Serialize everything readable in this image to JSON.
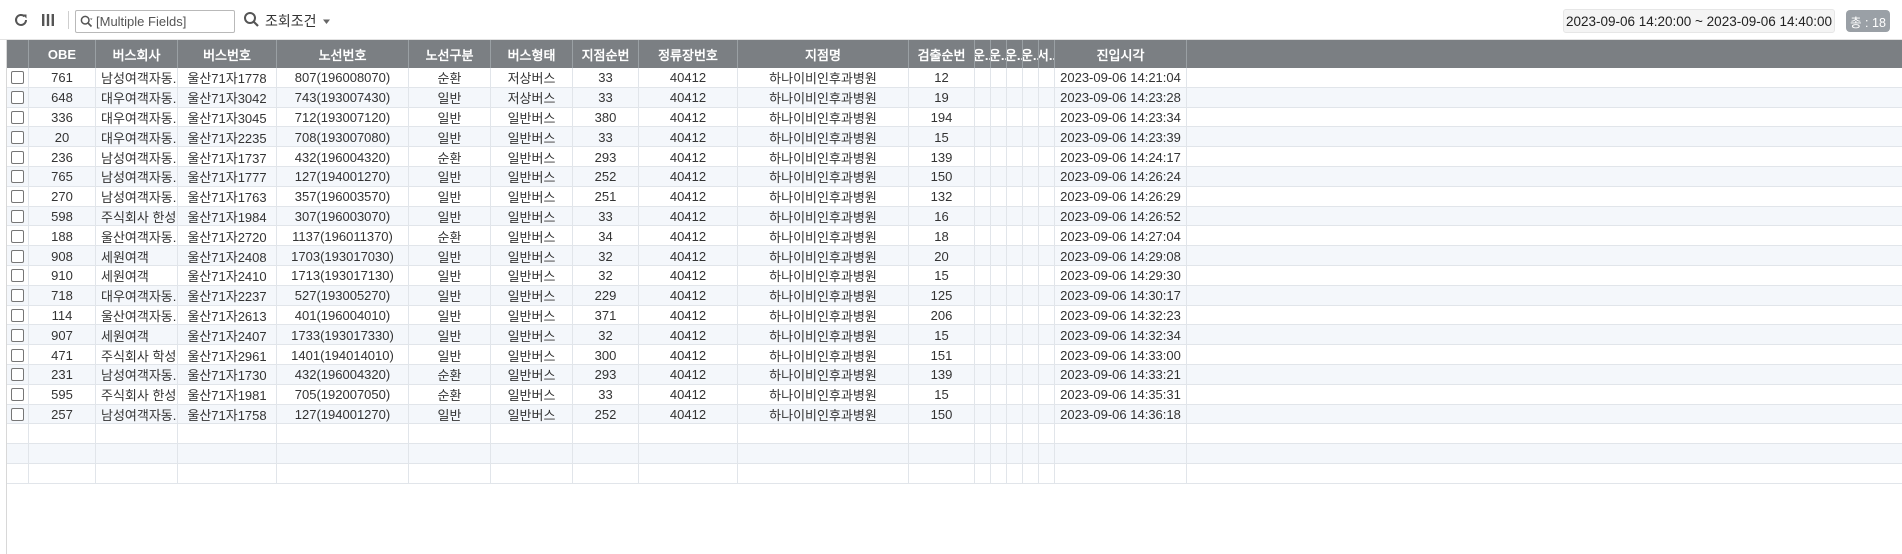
{
  "toolbar": {
    "search_placeholder": "[Multiple Fields]",
    "condition_label": "조회조건",
    "date_range": "2023-09-06 14:20:00 ~ 2023-09-06 14:40:00",
    "total_label": "총 : 18",
    "icons": [
      "refresh-icon",
      "columns-icon",
      "search-icon",
      "chevron-down-icon"
    ]
  },
  "table": {
    "columns": [
      "",
      "OBE",
      "버스회사",
      "버스번호",
      "노선번호",
      "노선구분",
      "버스형태",
      "지점순번",
      "정류장번호",
      "지점명",
      "검출순번",
      "운..",
      "운..",
      "운..",
      "운..",
      "서..",
      "진입시각"
    ],
    "rows": [
      [
        "761",
        "남성여객자동...",
        "울산71자1778",
        "807(196008070)",
        "순환",
        "저상버스",
        "33",
        "40412",
        "하나이비인후과병원",
        "12",
        "",
        "",
        "",
        "",
        "",
        "2023-09-06 14:21:04"
      ],
      [
        "648",
        "대우여객자동...",
        "울산71자3042",
        "743(193007430)",
        "일반",
        "저상버스",
        "33",
        "40412",
        "하나이비인후과병원",
        "19",
        "",
        "",
        "",
        "",
        "",
        "2023-09-06 14:23:28"
      ],
      [
        "336",
        "대우여객자동...",
        "울산71자3045",
        "712(193007120)",
        "일반",
        "일반버스",
        "380",
        "40412",
        "하나이비인후과병원",
        "194",
        "",
        "",
        "",
        "",
        "",
        "2023-09-06 14:23:34"
      ],
      [
        "20",
        "대우여객자동...",
        "울산71자2235",
        "708(193007080)",
        "일반",
        "일반버스",
        "33",
        "40412",
        "하나이비인후과병원",
        "15",
        "",
        "",
        "",
        "",
        "",
        "2023-09-06 14:23:39"
      ],
      [
        "236",
        "남성여객자동...",
        "울산71자1737",
        "432(196004320)",
        "순환",
        "일반버스",
        "293",
        "40412",
        "하나이비인후과병원",
        "139",
        "",
        "",
        "",
        "",
        "",
        "2023-09-06 14:24:17"
      ],
      [
        "765",
        "남성여객자동...",
        "울산71자1777",
        "127(194001270)",
        "일반",
        "일반버스",
        "252",
        "40412",
        "하나이비인후과병원",
        "150",
        "",
        "",
        "",
        "",
        "",
        "2023-09-06 14:26:24"
      ],
      [
        "270",
        "남성여객자동...",
        "울산71자1763",
        "357(196003570)",
        "일반",
        "일반버스",
        "251",
        "40412",
        "하나이비인후과병원",
        "132",
        "",
        "",
        "",
        "",
        "",
        "2023-09-06 14:26:29"
      ],
      [
        "598",
        "주식회사 한성...",
        "울산71자1984",
        "307(196003070)",
        "일반",
        "일반버스",
        "33",
        "40412",
        "하나이비인후과병원",
        "16",
        "",
        "",
        "",
        "",
        "",
        "2023-09-06 14:26:52"
      ],
      [
        "188",
        "울산여객자동...",
        "울산71자2720",
        "1137(196011370)",
        "순환",
        "일반버스",
        "34",
        "40412",
        "하나이비인후과병원",
        "18",
        "",
        "",
        "",
        "",
        "",
        "2023-09-06 14:27:04"
      ],
      [
        "908",
        "세원여객",
        "울산71자2408",
        "1703(193017030)",
        "일반",
        "일반버스",
        "32",
        "40412",
        "하나이비인후과병원",
        "20",
        "",
        "",
        "",
        "",
        "",
        "2023-09-06 14:29:08"
      ],
      [
        "910",
        "세원여객",
        "울산71자2410",
        "1713(193017130)",
        "일반",
        "일반버스",
        "32",
        "40412",
        "하나이비인후과병원",
        "15",
        "",
        "",
        "",
        "",
        "",
        "2023-09-06 14:29:30"
      ],
      [
        "718",
        "대우여객자동...",
        "울산71자2237",
        "527(193005270)",
        "일반",
        "일반버스",
        "229",
        "40412",
        "하나이비인후과병원",
        "125",
        "",
        "",
        "",
        "",
        "",
        "2023-09-06 14:30:17"
      ],
      [
        "114",
        "울산여객자동...",
        "울산71자2613",
        "401(196004010)",
        "일반",
        "일반버스",
        "371",
        "40412",
        "하나이비인후과병원",
        "206",
        "",
        "",
        "",
        "",
        "",
        "2023-09-06 14:32:23"
      ],
      [
        "907",
        "세원여객",
        "울산71자2407",
        "1733(193017330)",
        "일반",
        "일반버스",
        "32",
        "40412",
        "하나이비인후과병원",
        "15",
        "",
        "",
        "",
        "",
        "",
        "2023-09-06 14:32:34"
      ],
      [
        "471",
        "주식회사 학성...",
        "울산71자2961",
        "1401(194014010)",
        "일반",
        "일반버스",
        "300",
        "40412",
        "하나이비인후과병원",
        "151",
        "",
        "",
        "",
        "",
        "",
        "2023-09-06 14:33:00"
      ],
      [
        "231",
        "남성여객자동...",
        "울산71자1730",
        "432(196004320)",
        "순환",
        "일반버스",
        "293",
        "40412",
        "하나이비인후과병원",
        "139",
        "",
        "",
        "",
        "",
        "",
        "2023-09-06 14:33:21"
      ],
      [
        "595",
        "주식회사 한성...",
        "울산71자1981",
        "705(192007050)",
        "순환",
        "일반버스",
        "33",
        "40412",
        "하나이비인후과병원",
        "15",
        "",
        "",
        "",
        "",
        "",
        "2023-09-06 14:35:31"
      ],
      [
        "257",
        "남성여객자동...",
        "울산71자1758",
        "127(194001270)",
        "일반",
        "일반버스",
        "252",
        "40412",
        "하나이비인후과병원",
        "150",
        "",
        "",
        "",
        "",
        "",
        "2023-09-06 14:36:18"
      ]
    ]
  },
  "colors": {
    "header_bg": "#7b7f83",
    "row_alt_bg": "#f4f7fb",
    "badge_bg": "#9aa0a6"
  }
}
